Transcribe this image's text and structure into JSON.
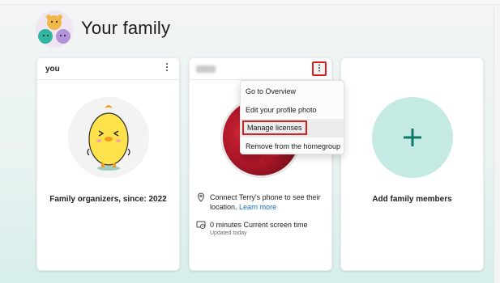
{
  "header": {
    "title": "Your family",
    "logo_icon": "family-bears-logo"
  },
  "cards": {
    "self": {
      "name": "you",
      "role": "Family organizers, since: 2022",
      "menu_icon": "more-vertical-icon"
    },
    "member": {
      "menu_icon": "more-vertical-icon",
      "location_text": "Connect Terry's phone to see their location.",
      "location_link": "Learn more",
      "screen_time": "0 minutes Current screen time",
      "updated": "Updated today"
    },
    "add": {
      "label": "Add family members",
      "icon": "plus-icon"
    }
  },
  "context_menu": {
    "items": [
      {
        "label": "Go to Overview"
      },
      {
        "label": "Edit your profile photo"
      },
      {
        "label": "Manage licenses"
      },
      {
        "label": "Remove from the homegroup"
      }
    ]
  },
  "colors": {
    "accent": "#0f7a6a",
    "highlight": "#d92020",
    "link": "#0f6cbd"
  }
}
